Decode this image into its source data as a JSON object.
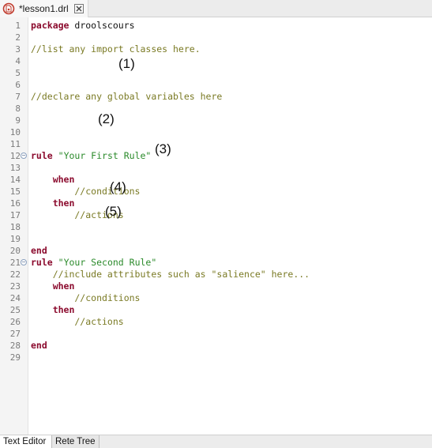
{
  "editor_tab": {
    "title": "*lesson1.drl",
    "icon": "drools-file-icon",
    "close_icon": "close-icon"
  },
  "code_lines": [
    {
      "n": "1",
      "parts": [
        {
          "t": "package",
          "c": "kw"
        },
        {
          "t": " droolscours",
          "c": "plain"
        }
      ]
    },
    {
      "n": "2",
      "parts": []
    },
    {
      "n": "3",
      "parts": [
        {
          "t": "//list any import classes here.",
          "c": "cm"
        }
      ]
    },
    {
      "n": "4",
      "parts": []
    },
    {
      "n": "5",
      "parts": []
    },
    {
      "n": "6",
      "parts": []
    },
    {
      "n": "7",
      "parts": [
        {
          "t": "//declare any global variables here",
          "c": "cm"
        }
      ]
    },
    {
      "n": "8",
      "parts": []
    },
    {
      "n": "9",
      "parts": []
    },
    {
      "n": "10",
      "parts": []
    },
    {
      "n": "11",
      "parts": []
    },
    {
      "n": "12",
      "fold": true,
      "parts": [
        {
          "t": "rule",
          "c": "kw"
        },
        {
          "t": " ",
          "c": "plain"
        },
        {
          "t": "\"Your First Rule\"",
          "c": "str"
        }
      ]
    },
    {
      "n": "13",
      "parts": []
    },
    {
      "n": "14",
      "parts": [
        {
          "t": "    ",
          "c": "plain"
        },
        {
          "t": "when",
          "c": "kw"
        }
      ]
    },
    {
      "n": "15",
      "parts": [
        {
          "t": "        //conditions",
          "c": "cm"
        }
      ]
    },
    {
      "n": "16",
      "parts": [
        {
          "t": "    ",
          "c": "plain"
        },
        {
          "t": "then",
          "c": "kw"
        }
      ]
    },
    {
      "n": "17",
      "parts": [
        {
          "t": "        //actions",
          "c": "cm"
        }
      ]
    },
    {
      "n": "18",
      "parts": []
    },
    {
      "n": "19",
      "parts": []
    },
    {
      "n": "20",
      "parts": [
        {
          "t": "end",
          "c": "kw"
        }
      ]
    },
    {
      "n": "21",
      "fold": true,
      "parts": [
        {
          "t": "rule",
          "c": "kw"
        },
        {
          "t": " ",
          "c": "plain"
        },
        {
          "t": "\"Your Second Rule\"",
          "c": "str"
        }
      ]
    },
    {
      "n": "22",
      "parts": [
        {
          "t": "    //include attributes such as \"salience\" here...",
          "c": "cm"
        }
      ]
    },
    {
      "n": "23",
      "parts": [
        {
          "t": "    ",
          "c": "plain"
        },
        {
          "t": "when",
          "c": "kw"
        }
      ]
    },
    {
      "n": "24",
      "parts": [
        {
          "t": "        //conditions",
          "c": "cm"
        }
      ]
    },
    {
      "n": "25",
      "parts": [
        {
          "t": "    ",
          "c": "plain"
        },
        {
          "t": "then",
          "c": "kw"
        }
      ]
    },
    {
      "n": "26",
      "parts": [
        {
          "t": "        //actions",
          "c": "cm"
        }
      ]
    },
    {
      "n": "27",
      "parts": []
    },
    {
      "n": "28",
      "parts": [
        {
          "t": "end",
          "c": "kw"
        }
      ]
    },
    {
      "n": "29",
      "parts": []
    }
  ],
  "annotations": [
    {
      "label": "(1)",
      "line": "4"
    },
    {
      "label": "(2)",
      "line": "9"
    },
    {
      "label": "(3)",
      "line": "12"
    },
    {
      "label": "(4)",
      "line": "15"
    },
    {
      "label": "(5)",
      "line": "17"
    }
  ],
  "bottom_tabs": [
    {
      "label": "Text Editor",
      "active": true
    },
    {
      "label": "Rete Tree",
      "active": false
    }
  ],
  "colors": {
    "keyword": "#8b0a2d",
    "comment": "#7a7a24",
    "string": "#2a8a2a"
  }
}
